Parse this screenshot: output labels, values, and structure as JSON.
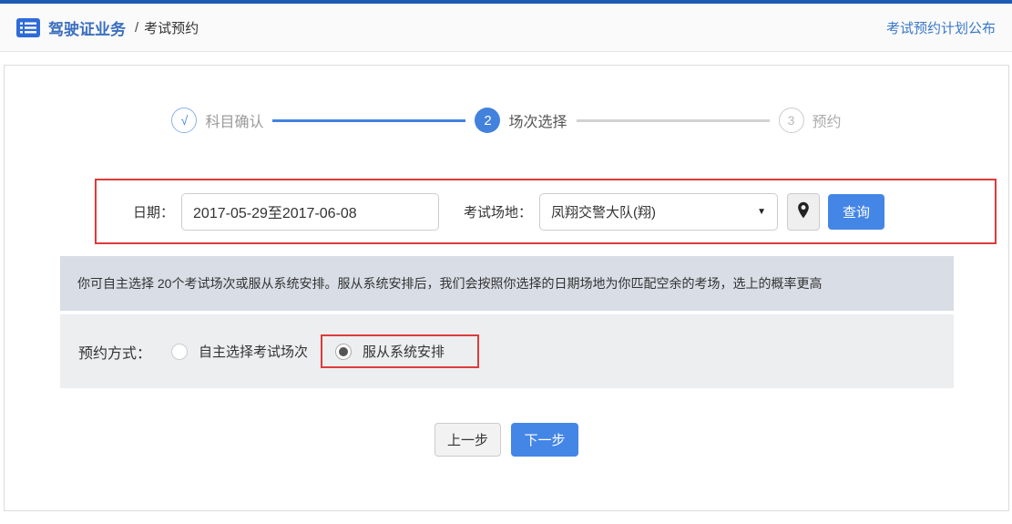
{
  "header": {
    "title": "驾驶证业务",
    "separator": "/",
    "subtitle": "考试预约",
    "link": "考试预约计划公布"
  },
  "stepper": {
    "steps": [
      {
        "marker": "√",
        "label": "科目确认",
        "state": "done"
      },
      {
        "marker": "2",
        "label": "场次选择",
        "state": "active"
      },
      {
        "marker": "3",
        "label": "预约",
        "state": "pending"
      }
    ]
  },
  "form": {
    "date_label": "日期：",
    "date_value": "2017-05-29至2017-06-08",
    "venue_label": "考试场地：",
    "venue_value": "凤翔交警大队(翔)",
    "dropdown_arrow": "▼",
    "search_button": "查询"
  },
  "notice": "你可自主选择 20个考试场次或服从系统安排。服从系统安排后，我们会按照你选择的日期场地为你匹配空余的考场，选上的概率更高",
  "booking": {
    "label": "预约方式：",
    "options": [
      {
        "label": "自主选择考试场次",
        "selected": false
      },
      {
        "label": "服从系统安排",
        "selected": true
      }
    ]
  },
  "actions": {
    "prev": "上一步",
    "next": "下一步"
  },
  "colors": {
    "accent_blue": "#4486e6",
    "link_blue": "#3a78c8",
    "top_line_blue": "#1d5bb5",
    "highlight_red": "#dd3b3b",
    "notice_bg": "#d8dde6",
    "booking_bg": "#eceef0"
  }
}
